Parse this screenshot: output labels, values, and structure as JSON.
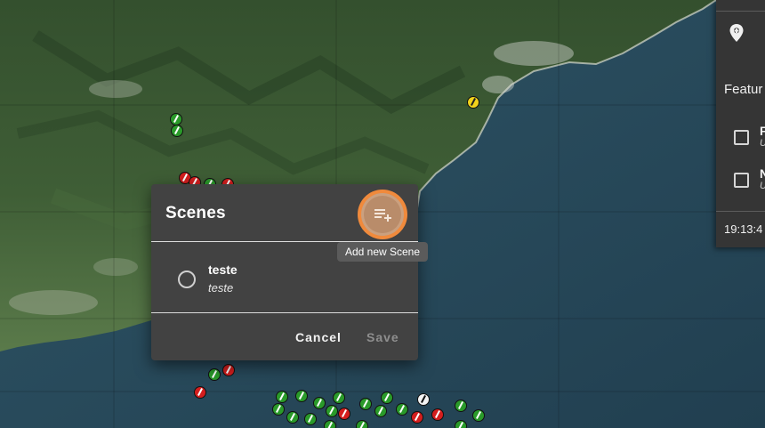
{
  "dialog": {
    "title": "Scenes",
    "add_scene_tooltip": "Add new Scene",
    "scenes": [
      {
        "name": "teste",
        "description": "teste",
        "selected": false
      }
    ],
    "cancel_label": "Cancel",
    "save_label": "Save",
    "save_enabled": false
  },
  "side_panel": {
    "features_label": "Featur",
    "rows": [
      {
        "title": "F",
        "subtitle": "U"
      },
      {
        "title": "N",
        "subtitle": "U"
      }
    ],
    "time": "19:13:4"
  },
  "icons": {
    "panel_pin": "map-pin-icon",
    "add_scene": "playlist-add-icon"
  },
  "colors": {
    "marker_green": "#2a9a2a",
    "marker_red": "#d41e1e",
    "marker_yellow": "#f2d21b",
    "marker_white": "#f4f4f4",
    "focus_ring": "#f08a3c",
    "dialog_bg": "#424242"
  }
}
